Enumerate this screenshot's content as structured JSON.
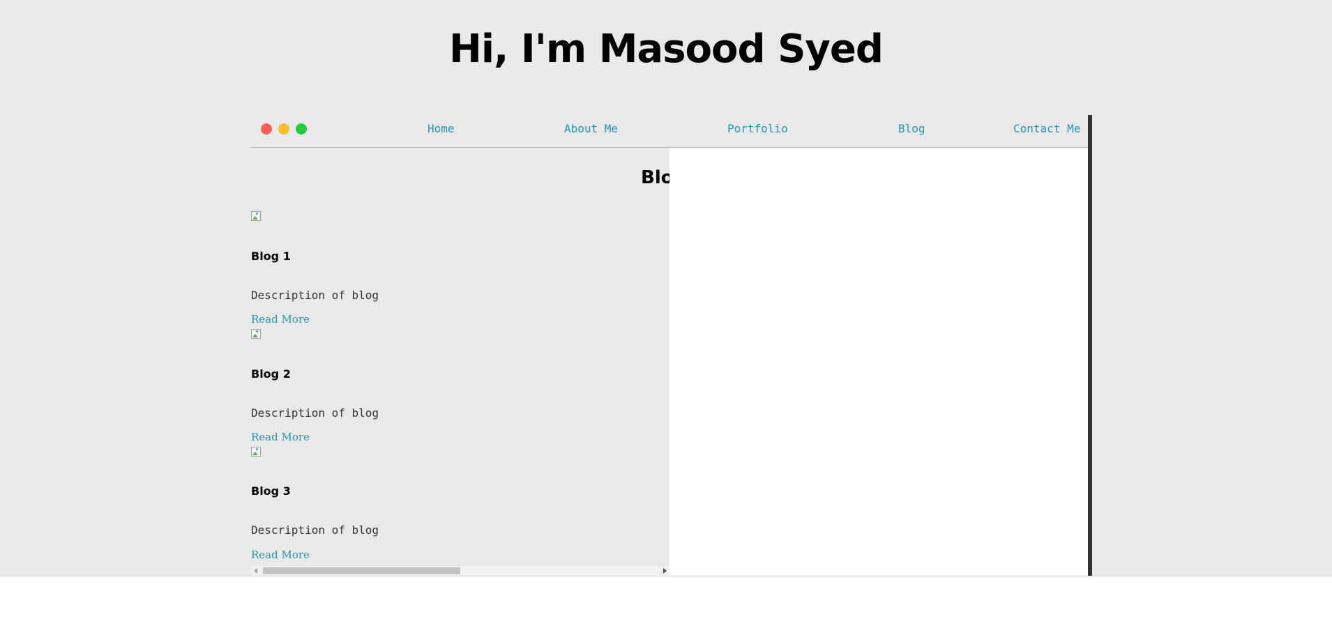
{
  "header": {
    "title": "Hi, I'm Masood Syed"
  },
  "window": {
    "traffic_lights": {
      "close": "#ff5f56",
      "minimize": "#ffbd2e",
      "maximize": "#27c93f"
    }
  },
  "nav": {
    "link_color": "#2a93b2",
    "items": [
      {
        "label": "Home"
      },
      {
        "label": "About Me"
      },
      {
        "label": "Portfolio"
      },
      {
        "label": "Blog"
      },
      {
        "label": "Contact Me"
      }
    ]
  },
  "main": {
    "heading": "Blog",
    "posts": [
      {
        "title": "Blog 1",
        "description": "Description of blog",
        "link": "Read More",
        "image_icon": "broken-image-icon"
      },
      {
        "title": "Blog 2",
        "description": "Description of blog",
        "link": "Read More",
        "image_icon": "broken-image-icon"
      },
      {
        "title": "Blog 3",
        "description": "Description of blog",
        "link": "Read More",
        "image_icon": "broken-image-icon"
      }
    ]
  },
  "scrollbar": {
    "position": 0.0
  }
}
